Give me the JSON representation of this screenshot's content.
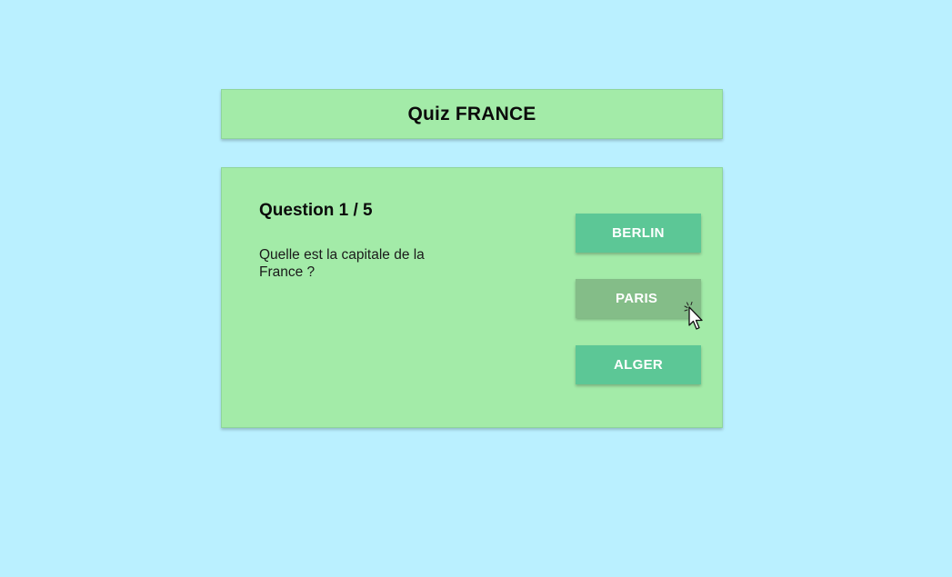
{
  "header": {
    "title": "Quiz FRANCE"
  },
  "question": {
    "counter": "Question 1 / 5",
    "text": "Quelle est la capitale de la France ?"
  },
  "answers": [
    {
      "label": "BERLIN",
      "state": "default"
    },
    {
      "label": "PARIS",
      "state": "hover"
    },
    {
      "label": "ALGER",
      "state": "default"
    }
  ],
  "colors": {
    "background": "#baf0ff",
    "card": "#a3eba8",
    "answer": "#5cc796",
    "answer_hover": "#84bd88",
    "answer_text": "#ffffff"
  },
  "cursor": {
    "icon": "pointer-click-icon"
  }
}
